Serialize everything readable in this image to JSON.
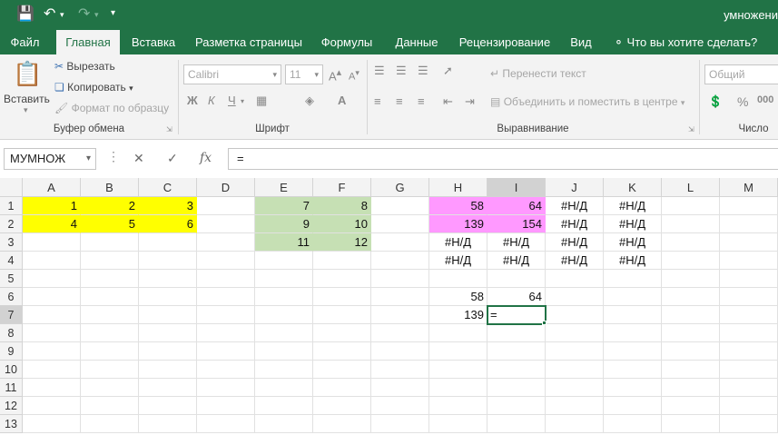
{
  "title_bar": {
    "doc_title": "умножени"
  },
  "tabs": [
    {
      "label": "Файл",
      "active": false
    },
    {
      "label": "Главная",
      "active": true
    },
    {
      "label": "Вставка",
      "active": false
    },
    {
      "label": "Разметка страницы",
      "active": false
    },
    {
      "label": "Формулы",
      "active": false
    },
    {
      "label": "Данные",
      "active": false
    },
    {
      "label": "Рецензирование",
      "active": false
    },
    {
      "label": "Вид",
      "active": false
    },
    {
      "label": "Что вы хотите сделать?",
      "active": false
    }
  ],
  "ribbon": {
    "clipboard": {
      "paste": "Вставить",
      "cut": "Вырезать",
      "copy": "Копировать",
      "format_painter": "Формат по образцу",
      "group": "Буфер обмена"
    },
    "font": {
      "name": "Calibri",
      "size": "11",
      "bold": "Ж",
      "italic": "К",
      "underline": "Ч",
      "group": "Шрифт"
    },
    "alignment": {
      "wrap": "Перенести текст",
      "merge": "Объединить и поместить в центре",
      "group": "Выравнивание"
    },
    "number": {
      "format": "Общий",
      "group": "Число"
    }
  },
  "formula_bar": {
    "name_box": "МУМНОЖ",
    "cancel": "✕",
    "enter": "✓",
    "fx": "fx",
    "formula": "="
  },
  "columns": [
    "A",
    "B",
    "C",
    "D",
    "E",
    "F",
    "G",
    "H",
    "I",
    "J",
    "K",
    "L",
    "M"
  ],
  "rows": [
    "1",
    "2",
    "3",
    "4",
    "5",
    "6",
    "7",
    "8",
    "9",
    "10",
    "11",
    "12",
    "13"
  ],
  "cells": {
    "A1": "1",
    "B1": "2",
    "C1": "3",
    "A2": "4",
    "B2": "5",
    "C2": "6",
    "E1": "7",
    "F1": "8",
    "E2": "9",
    "F2": "10",
    "E3": "11",
    "F3": "12",
    "H1": "58",
    "I1": "64",
    "J1": "#Н/Д",
    "K1": "#Н/Д",
    "H2": "139",
    "I2": "154",
    "J2": "#Н/Д",
    "K2": "#Н/Д",
    "H3": "#Н/Д",
    "I3": "#Н/Д",
    "J3": "#Н/Д",
    "K3": "#Н/Д",
    "H4": "#Н/Д",
    "I4": "#Н/Д",
    "J4": "#Н/Д",
    "K4": "#Н/Д",
    "H6": "58",
    "I6": "64",
    "H7": "139",
    "I7": "="
  },
  "fills": {
    "yellow": "#ffff00",
    "green": "#c6e0b4",
    "pink": "#ff99ff"
  },
  "active_cell": "I7",
  "accent": "#217346"
}
